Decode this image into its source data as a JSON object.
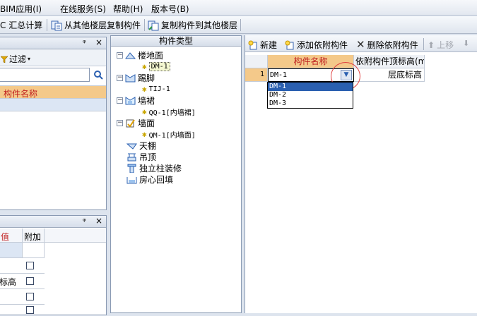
{
  "menu": {
    "items": [
      "BIM应用(I)",
      "在线服务(S)",
      "帮助(H)",
      "版本号(B)"
    ]
  },
  "toolbar": {
    "summary_label": "C 汇总计算",
    "copy_from_label": "从其他楼层复制构件",
    "copy_to_label": "复制构件到其他楼层"
  },
  "left_panel": {
    "pin": "ᵠ",
    "close": "×",
    "filter_label": "过滤",
    "column_header": "构件名称"
  },
  "left_bottom_panel": {
    "col_value": "值",
    "col_attach": "附加",
    "row_text": "标高"
  },
  "component_type": {
    "header": "构件类型",
    "tree": [
      {
        "label": "楼地面",
        "child": "DM-1"
      },
      {
        "label": "踢脚",
        "child": "TIJ-1"
      },
      {
        "label": "墙裙",
        "child": "QQ-1[内墙裙]"
      },
      {
        "label": "墙面",
        "child": "QM-1[内墙面]"
      },
      {
        "label": "天棚"
      },
      {
        "label": "吊顶"
      },
      {
        "label": "独立柱装修"
      },
      {
        "label": "房心回填"
      }
    ]
  },
  "right_toolbar": {
    "new_label": "新建",
    "add_attach_label": "添加依附构件",
    "del_attach_label": "删除依附构件",
    "move_up_label": "上移"
  },
  "grid": {
    "col_name": "构件名称",
    "col_top": "依附构件顶标高(m",
    "row_num": "1",
    "row_value": "DM-1",
    "row_top": "层底标高"
  },
  "dropdown": {
    "options": [
      "DM-1",
      "DM-2",
      "DM-3"
    ],
    "selected": 0
  },
  "colors": {
    "accent_orange": "#f4c98a",
    "highlight_blue": "#2a5fb0",
    "circle_red": "#e04040"
  }
}
